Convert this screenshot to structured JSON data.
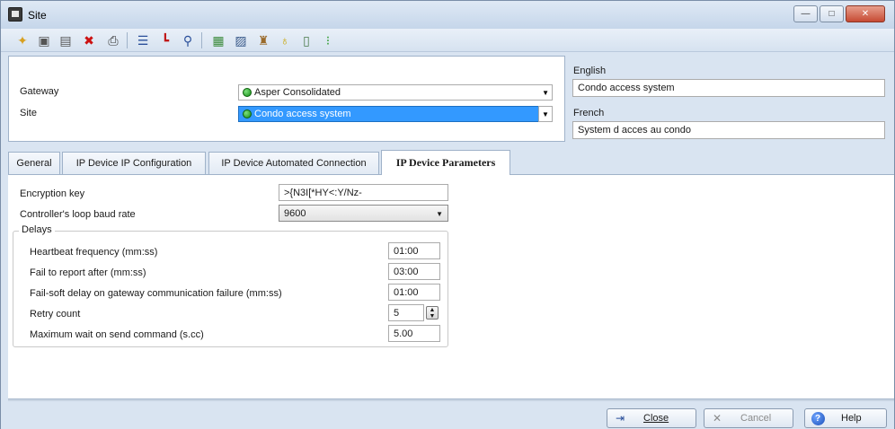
{
  "window": {
    "title": "Site",
    "controls": {
      "minimize": "—",
      "maximize": "□",
      "close": "✕"
    }
  },
  "toolbar": {
    "items": [
      {
        "name": "new-icon",
        "glyph": "✦",
        "color": "#d8a020"
      },
      {
        "name": "save-icon",
        "glyph": "▣",
        "color": "#555555"
      },
      {
        "name": "save-close-icon",
        "glyph": "▤",
        "color": "#555555"
      },
      {
        "name": "delete-icon",
        "glyph": "✖",
        "color": "#cc1111"
      },
      {
        "name": "print-icon",
        "glyph": "⎙",
        "color": "#333333"
      },
      {
        "name": "list-icon",
        "glyph": "☰",
        "color": "#2a4f9a"
      },
      {
        "name": "link-icon",
        "glyph": "┗",
        "color": "#c01818"
      },
      {
        "name": "search-icon",
        "glyph": "⚲",
        "color": "#2a4f9a"
      },
      {
        "name": "grid-icon",
        "glyph": "▦",
        "color": "#3a8a3a"
      },
      {
        "name": "report-icon",
        "glyph": "▨",
        "color": "#3a5a8a"
      },
      {
        "name": "user-icon",
        "glyph": "♜",
        "color": "#9a6a2a"
      },
      {
        "name": "lightbulb-icon",
        "glyph": "♁",
        "color": "#c9a400"
      },
      {
        "name": "panel-icon",
        "glyph": "▯",
        "color": "#4a7a4a"
      },
      {
        "name": "status-icon",
        "glyph": "⁝",
        "color": "#2a9a2a"
      }
    ]
  },
  "header": {
    "gateway_label": "Gateway",
    "gateway_value": "Asper Consolidated",
    "site_label": "Site",
    "site_value": "Condo access system"
  },
  "lang": {
    "english_label": "English",
    "english_value": "Condo access system",
    "french_label": "French",
    "french_value": "System d acces au condo"
  },
  "tabs": [
    {
      "label": "General"
    },
    {
      "label": "IP Device IP Configuration"
    },
    {
      "label": "IP Device Automated Connection"
    },
    {
      "label": "IP Device Parameters"
    }
  ],
  "params": {
    "encryption_label": "Encryption key",
    "encryption_value": ">{N3I[*HY<:Y/Nz-",
    "baud_label": "Controller's loop baud rate",
    "baud_value": "9600",
    "delays_legend": "Delays",
    "heartbeat_label": "Heartbeat frequency (mm:ss)",
    "heartbeat_value": "01:00",
    "fail_report_label": "Fail to report after (mm:ss)",
    "fail_report_value": "03:00",
    "failsoft_label": "Fail-soft delay on gateway communication failure (mm:ss)",
    "failsoft_value": "01:00",
    "retry_label": "Retry count",
    "retry_value": "5",
    "maxwait_label": "Maximum wait on send command (s.cc)",
    "maxwait_value": "5.00"
  },
  "footer": {
    "close_label": "Close",
    "cancel_label": "Cancel",
    "help_label": "Help"
  },
  "colors": {
    "selection": "#3399ff",
    "chrome": "#d9e4f1"
  }
}
